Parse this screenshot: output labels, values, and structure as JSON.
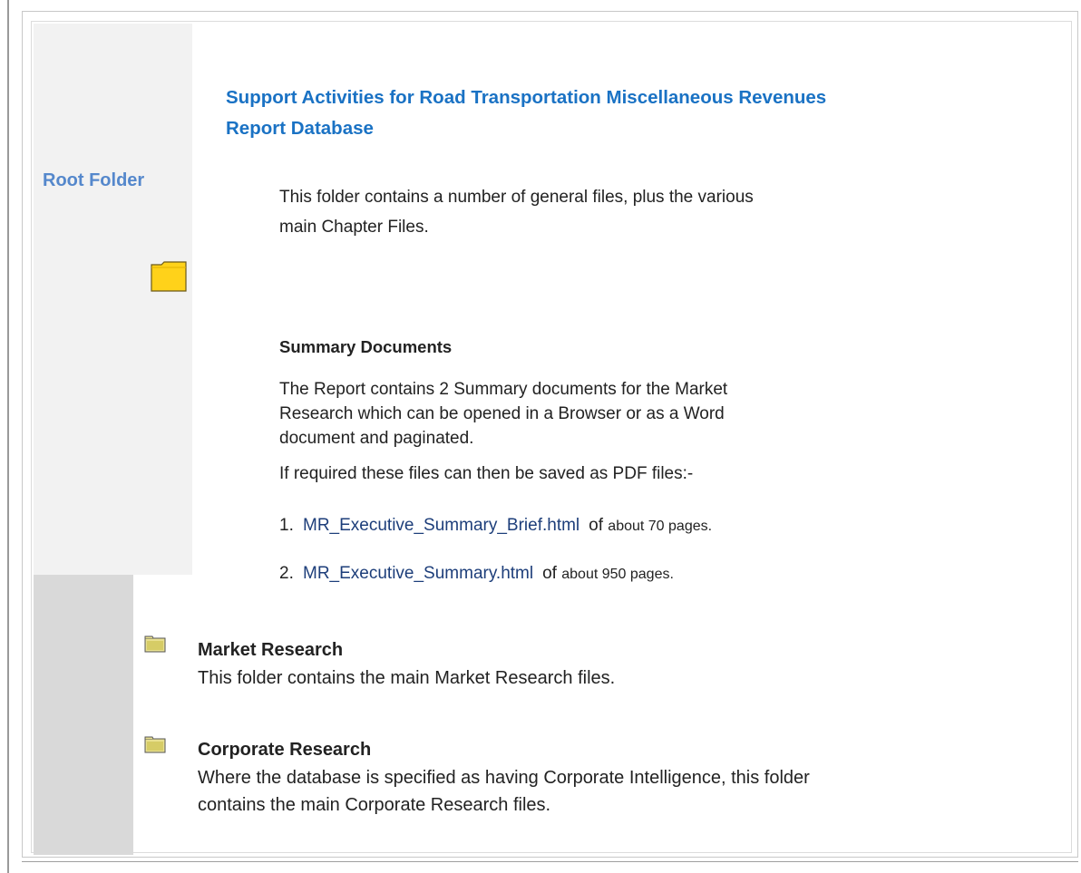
{
  "sidebar": {
    "label": "Root Folder",
    "folder_icon": "folder-icon"
  },
  "header": {
    "title_line1": "Support Activities for Road Transportation Miscellaneous Revenues",
    "title_line2": "Report Database"
  },
  "intro": {
    "line1": "This folder contains a number of general files, plus the various",
    "line2": "main Chapter Files."
  },
  "summary": {
    "heading": "Summary Documents",
    "para_line1": "The Report contains 2 Summary documents for the Market",
    "para_line2": "Research which can be opened in a Browser or as a Word",
    "para_line3": "document and paginated.",
    "para2": "If required these files can then be saved as PDF files:-",
    "items": [
      {
        "number": "1.",
        "link": "MR_Executive_Summary_Brief.html",
        "tail_a": "of",
        "tail_b": "about 70 pages."
      },
      {
        "number": "2.",
        "link": "MR_Executive_Summary.html",
        "tail_a": "of",
        "tail_b": "about 950 pages."
      }
    ]
  },
  "subfolders": [
    {
      "title": "Market Research",
      "desc_line1": "This folder contains the main Market Research files.",
      "desc_line2": ""
    },
    {
      "title": "Corporate Research",
      "desc_line1": "Where the database is specified as having Corporate Intelligence, this folder",
      "desc_line2": "contains the main Corporate Research files."
    }
  ],
  "colors": {
    "title": "#1a72c4",
    "root_label": "#5588cc",
    "link": "#1d3e7a",
    "folder_yellow": "#ffd21a"
  }
}
